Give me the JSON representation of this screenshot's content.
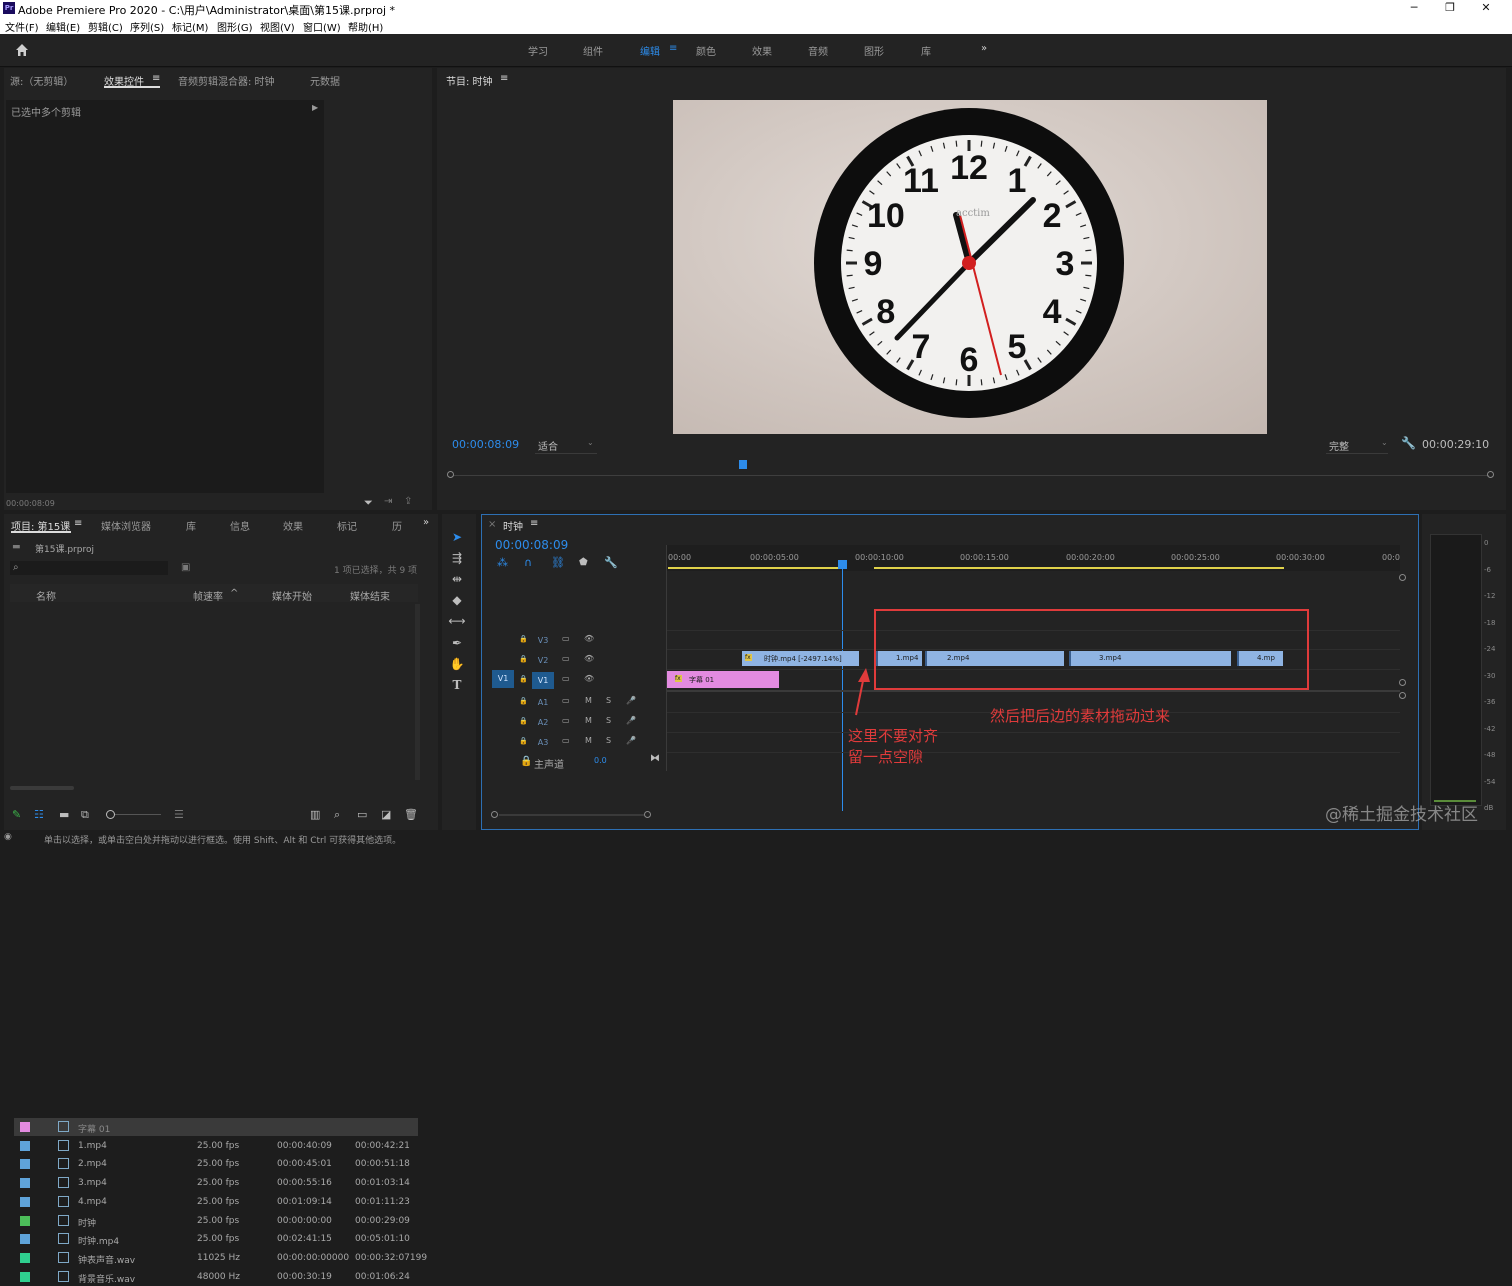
{
  "window": {
    "title": "Adobe Premiere Pro 2020 - C:\\用户\\Administrator\\桌面\\第15课.prproj *",
    "app_icon": "Pr",
    "controls": [
      "─",
      "❐",
      "✕"
    ]
  },
  "menu": [
    "文件(F)",
    "编辑(E)",
    "剪辑(C)",
    "序列(S)",
    "标记(M)",
    "图形(G)",
    "视图(V)",
    "窗口(W)",
    "帮助(H)"
  ],
  "workspaces": {
    "items": [
      "学习",
      "组件",
      "编辑",
      "颜色",
      "效果",
      "音频",
      "图形",
      "库"
    ],
    "active": "编辑",
    "menu_glyph": "≡",
    "overflow": "»"
  },
  "source_panel": {
    "tabs": [
      "源:（无剪辑）",
      "效果控件",
      "音频剪辑混合器: 时钟",
      "元数据"
    ],
    "active_tab": "效果控件",
    "tab_menu": "≡",
    "selected_info": "已选中多个剪辑",
    "timecode": "00:00:08:09"
  },
  "program_monitor": {
    "title": "节目: 时钟",
    "menu": "≡",
    "timecode": "00:00:08:09",
    "fit": "适合",
    "quality": "完整",
    "duration": "00:00:29:10",
    "clock_numbers": [
      "12",
      "1",
      "2",
      "3",
      "4",
      "5",
      "6",
      "7",
      "8",
      "9",
      "10",
      "11"
    ],
    "clock_brand": "acctim",
    "playhead_fraction": 0.28
  },
  "project_panel": {
    "tabs": [
      "项目: 第15课",
      "媒体浏览器",
      "库",
      "信息",
      "效果",
      "标记",
      "历"
    ],
    "active_tab": "项目: 第15课",
    "tab_menu": "≡",
    "overflow": "»",
    "project_file": "第15课.prproj",
    "selection_status": "1 项已选择，共 9 项",
    "columns": [
      "名称",
      "帧速率",
      "媒体开始",
      "媒体结束"
    ],
    "sort_glyph": "^",
    "rows": [
      {
        "name": "字幕 01",
        "fps": "",
        "start": "",
        "end": "",
        "color": "#e38be0",
        "selected": true
      },
      {
        "name": "1.mp4",
        "fps": "25.00 fps",
        "start": "00:00:40:09",
        "end": "00:00:42:21",
        "color": "#5fa3d9"
      },
      {
        "name": "2.mp4",
        "fps": "25.00 fps",
        "start": "00:00:45:01",
        "end": "00:00:51:18",
        "color": "#5fa3d9"
      },
      {
        "name": "3.mp4",
        "fps": "25.00 fps",
        "start": "00:00:55:16",
        "end": "00:01:03:14",
        "color": "#5fa3d9"
      },
      {
        "name": "4.mp4",
        "fps": "25.00 fps",
        "start": "00:01:09:14",
        "end": "00:01:11:23",
        "color": "#5fa3d9"
      },
      {
        "name": "时钟",
        "fps": "25.00 fps",
        "start": "00:00:00:00",
        "end": "00:00:29:09",
        "color": "#4cbd59"
      },
      {
        "name": "时钟.mp4",
        "fps": "25.00 fps",
        "start": "00:02:41:15",
        "end": "00:05:01:10",
        "color": "#5fa3d9"
      },
      {
        "name": "钟表声音.wav",
        "fps": "11025 Hz",
        "start": "00:00:00:00000",
        "end": "00:00:32:07199",
        "color": "#2fcf8f"
      },
      {
        "name": "背景音乐.wav",
        "fps": "48000 Hz",
        "start": "00:00:30:19",
        "end": "00:01:06:24",
        "color": "#2fcf8f"
      }
    ]
  },
  "timeline": {
    "close": "×",
    "title": "时钟",
    "menu": "≡",
    "timecode": "00:00:08:09",
    "ruler": [
      "00:00",
      "00:00:05:00",
      "00:00:10:00",
      "00:00:15:00",
      "00:00:20:00",
      "00:00:25:00",
      "00:00:30:00",
      "00:0"
    ],
    "tracks": [
      {
        "id": "V3",
        "toggles": [
          "🔒",
          "▭",
          "👁"
        ]
      },
      {
        "id": "V2",
        "toggles": [
          "🔒",
          "▭",
          "👁"
        ]
      },
      {
        "id": "V1",
        "source": "V1",
        "toggles": [
          "🔒",
          "▭",
          "👁"
        ]
      },
      {
        "id": "A1",
        "toggles": [
          "🔒",
          "▭",
          "M",
          "S",
          "🎤"
        ]
      },
      {
        "id": "A2",
        "toggles": [
          "🔒",
          "▭",
          "M",
          "S",
          "🎤"
        ]
      },
      {
        "id": "A3",
        "toggles": [
          "🔒",
          "▭",
          "M",
          "S",
          "🎤"
        ]
      }
    ],
    "master": {
      "label": "主声道",
      "value": "0.0"
    },
    "clips": [
      {
        "label": "时钟.mp4 [-2497.14%]",
        "track": "V2",
        "fx": "fx",
        "color": "#8fb4e3"
      },
      {
        "label": "字幕 01",
        "track": "V1",
        "fx": "fx",
        "color": "#e38be0"
      },
      {
        "label": "1.mp4",
        "track": "V2",
        "color": "#8fb4e3"
      },
      {
        "label": "2.mp4",
        "track": "V2",
        "color": "#8fb4e3"
      },
      {
        "label": "3.mp4",
        "track": "V2",
        "color": "#8fb4e3"
      },
      {
        "label": "4.mp",
        "track": "V2",
        "color": "#8fb4e3"
      }
    ]
  },
  "meter_scale": [
    "0",
    "-6",
    "-12",
    "-18",
    "-24",
    "-30",
    "-36",
    "-42",
    "-48",
    "-54",
    "dB"
  ],
  "annotations": {
    "right": "然后把后边的素材拖动过来",
    "left_line1": "这里不要对齐",
    "left_line2": "留一点空隙",
    "color": "#e03b3b"
  },
  "status_bar": "单击以选择，或单击空白处并拖动以进行框选。使用 Shift、Alt 和 Ctrl 可获得其他选项。",
  "watermark": "@稀土掘金技术社区"
}
